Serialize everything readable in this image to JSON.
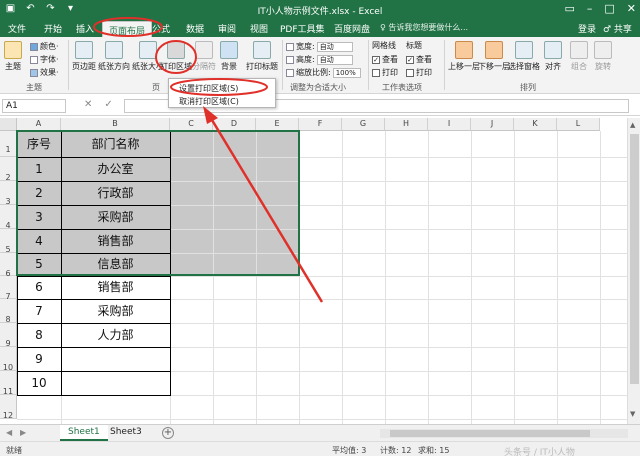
{
  "window": {
    "title": "IT小人物示例文件.xlsx - Excel",
    "qat": [
      "save-icon",
      "undo-icon",
      "redo-icon",
      "customize-icon"
    ],
    "controls": [
      "ribbon-options-icon",
      "minimize-icon",
      "maximize-icon",
      "close-icon"
    ]
  },
  "tabs": {
    "file": "文件",
    "home": "开始",
    "insert": "插入",
    "page_layout": "页面布局",
    "formulas": "公式",
    "data": "数据",
    "review": "审阅",
    "view": "视图",
    "pdf": "PDF工具集",
    "baidu": "百度网盘",
    "tell_me": "♀ 告诉我您想要做什么...",
    "login": "登录",
    "share": "♂ 共享"
  },
  "ribbon": {
    "themes": "主题",
    "colors": "颜色·",
    "fonts": "字体·",
    "effects": "效果·",
    "themes_group": "主题",
    "margins": "页边距",
    "orientation": "纸张方向",
    "size": "纸张大小",
    "print_area": "打印区域",
    "breaks": "分隔符",
    "background": "背景",
    "print_titles": "打印标题",
    "page_setup_group": "页",
    "width_label": "宽度:",
    "width_value": "自动",
    "height_label": "高度:",
    "height_value": "自动",
    "scale_label": "缩放比例:",
    "scale_value": "100%",
    "fit_group": "调整为合适大小",
    "gridlines": "网格线",
    "headings": "标题",
    "view_gridlines": "查看",
    "view_headings": "查看",
    "print_gridlines": "打印",
    "print_headings": "打印",
    "sheet_options_group": "工作表选项",
    "bring_forward": "上移一层",
    "send_backward": "下移一层",
    "selection_pane": "选择窗格",
    "align": "对齐",
    "group": "组合",
    "rotate": "旋转",
    "arrange_group": "排列"
  },
  "menu": {
    "set_print_area": "设置打印区域(S)",
    "clear_print_area": "取消打印区域(C)"
  },
  "formula_bar": {
    "name_box": "A1",
    "cancel": "✕",
    "enter": "✓",
    "fx": "fx"
  },
  "columns": [
    "A",
    "B",
    "C",
    "D",
    "E",
    "F",
    "G",
    "H",
    "I",
    "J",
    "K",
    "L"
  ],
  "rows": [
    "1",
    "2",
    "3",
    "4",
    "5",
    "6",
    "7",
    "8",
    "9",
    "10",
    "11",
    "12"
  ],
  "table": {
    "headers": [
      "序号",
      "部门名称"
    ],
    "rows": [
      [
        "1",
        "办公室"
      ],
      [
        "2",
        "行政部"
      ],
      [
        "3",
        "采购部"
      ],
      [
        "4",
        "销售部"
      ],
      [
        "5",
        "信息部"
      ],
      [
        "6",
        "销售部"
      ],
      [
        "7",
        "采购部"
      ],
      [
        "8",
        "人力部"
      ],
      [
        "9",
        ""
      ],
      [
        "10",
        ""
      ]
    ]
  },
  "sheets": {
    "tabs": [
      "Sheet1",
      "Sheet3"
    ],
    "active": "Sheet1",
    "add": "+"
  },
  "status": {
    "ready": "就绪",
    "average": "平均值: 3",
    "count": "计数: 12",
    "sum": "求和: 15"
  },
  "watermark": "头条号 / IT小人物",
  "colors": {
    "excel_green": "#217346",
    "annotation_red": "#e0302a",
    "print_area_fill": "#c8c8c8"
  }
}
